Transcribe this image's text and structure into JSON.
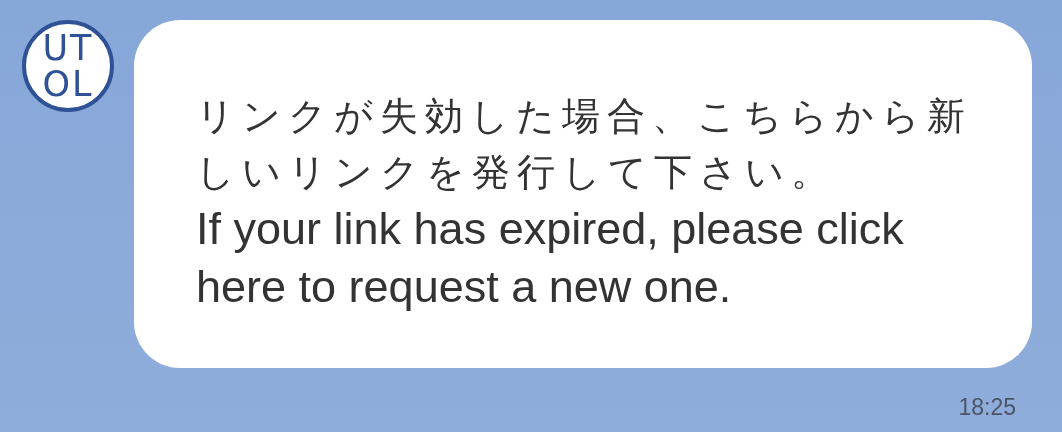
{
  "avatar": {
    "logo_lines": [
      "UT",
      "OL"
    ]
  },
  "message": {
    "paragraphs": [
      {
        "kind": "japanese",
        "text": "リンクが失効した場合、こちらから新しいリンクを発行して下さい。"
      },
      {
        "kind": "latin",
        "text": "If your link has expired, please click here to request a new one."
      }
    ],
    "time": "18:25"
  }
}
